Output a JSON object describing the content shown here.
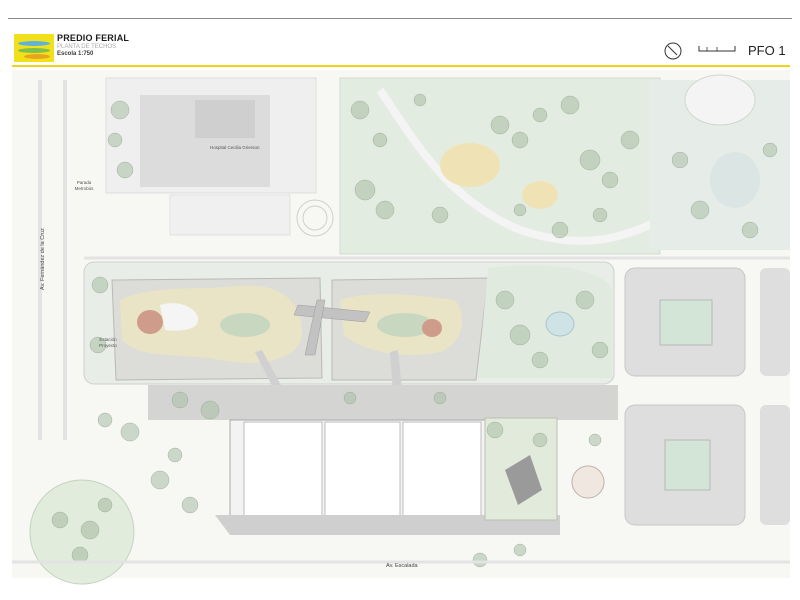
{
  "header": {
    "title": "PREDIO FERIAL",
    "subtitle": "PLANTA DE TECHOS",
    "scale": "Escola 1:750",
    "sheet_id": "PFO 1"
  },
  "plan_labels": {
    "hospital": "Hospital Cecilia Grierson",
    "parada": "Parada Metrobús",
    "estacion": "Estación Proyecto",
    "av_fernandez": "Av. Fernández de la Cruz",
    "av_escalada": "Av. Escalada"
  },
  "colors": {
    "accent_yellow": "#f0d31a",
    "vegetation_green": "#9fb59a",
    "building_grey": "#d9d9d9",
    "paving_grey": "#bfbfbf"
  },
  "icons": {
    "north": "north-arrow-icon",
    "scale": "graphic-scale-icon",
    "logo": "project-logo-icon"
  }
}
